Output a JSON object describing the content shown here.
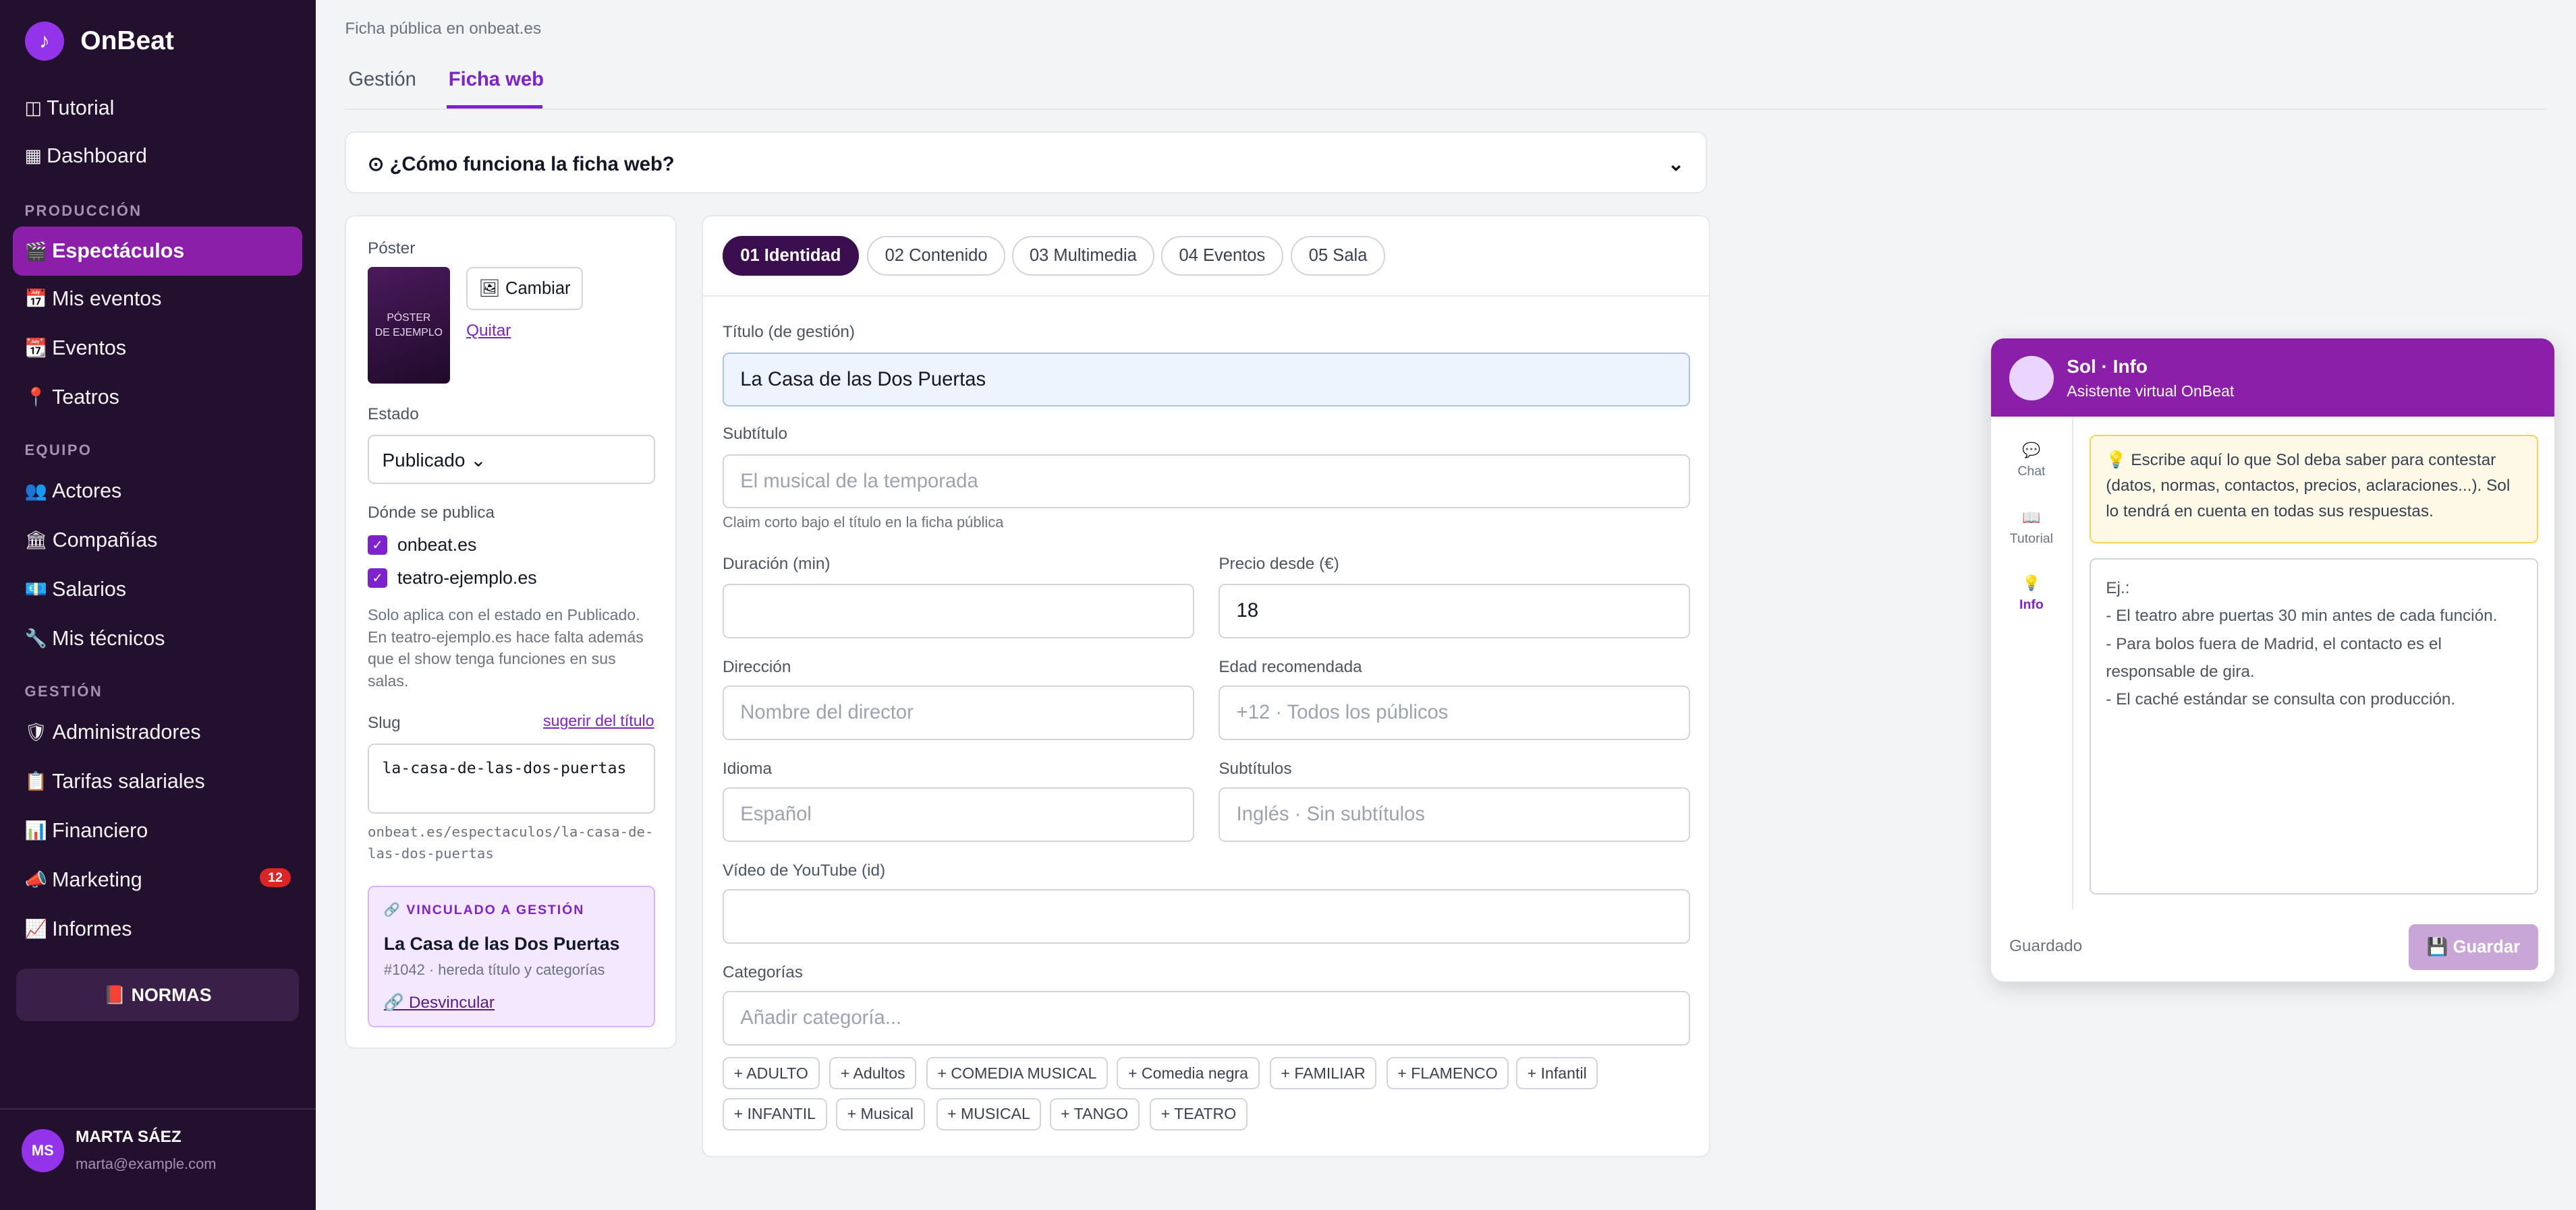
{
  "brand": {
    "logo_icon": "♪",
    "name": "OnBeat"
  },
  "sidebar": {
    "items_top": [
      {
        "icon": "◫",
        "label": "Tutorial"
      },
      {
        "icon": "▦",
        "label": "Dashboard"
      }
    ],
    "section_produccion": "PRODUCCIÓN",
    "items_produccion": [
      {
        "icon": "🎬",
        "label": "Espectáculos"
      },
      {
        "icon": "📅",
        "label": "Mis eventos"
      },
      {
        "icon": "📆",
        "label": "Eventos"
      },
      {
        "icon": "📍",
        "label": "Teatros"
      }
    ],
    "section_equipo": "EQUIPO",
    "items_equipo": [
      {
        "icon": "👥",
        "label": "Actores"
      },
      {
        "icon": "🏛",
        "label": "Compañías"
      },
      {
        "icon": "💶",
        "label": "Salarios"
      },
      {
        "icon": "🔧",
        "label": "Mis técnicos"
      }
    ],
    "section_gestion": "GESTIÓN",
    "items_gestion": [
      {
        "icon": "🛡",
        "label": "Administradores"
      },
      {
        "icon": "📋",
        "label": "Tarifas salariales"
      },
      {
        "icon": "📊",
        "label": "Financiero"
      },
      {
        "icon": "📣",
        "label": "Marketing",
        "badge": "12"
      },
      {
        "icon": "📈",
        "label": "Informes"
      }
    ],
    "normas_label": "📕 NORMAS",
    "user": {
      "initials": "MS",
      "name": "MARTA SÁEZ",
      "email": "marta@example.com"
    }
  },
  "main": {
    "breadcrumb": "Ficha pública en onbeat.es",
    "tabs": [
      {
        "label": "Gestión"
      },
      {
        "label": "Ficha web"
      }
    ],
    "accordion_title": "⊙ ¿Cómo funciona la ficha web?",
    "accordion_chevron": "⌄",
    "left": {
      "poster_label": "Póster",
      "poster_caption_1": "PÓSTER",
      "poster_caption_2": "DE EJEMPLO",
      "change_button": "🖼 Cambiar",
      "remove_link": "Quitar",
      "estado_label": "Estado",
      "estado_value": "Publicado ⌄",
      "publish_label": "Dónde se publica",
      "channels": [
        {
          "label": "onbeat.es",
          "checked": true
        },
        {
          "label": "teatro-ejemplo.es",
          "checked": true
        }
      ],
      "publish_note": "Solo aplica con el estado en Publicado. En teatro-ejemplo.es hace falta además que el show tenga funciones en sus salas.",
      "slug_label": "Slug",
      "slug_suggest": "sugerir del título",
      "slug_value": "la-casa-de-las-dos-puertas",
      "slug_url": "onbeat.es/espectaculos/la-casa-de-las-dos-puertas",
      "linked": {
        "tag": "🔗 VINCULADO A GESTIÓN",
        "title": "La Casa de las Dos Puertas",
        "subtitle": "#1042 · hereda título y categorías",
        "unlink": "🔗 Desvincular"
      }
    },
    "step_tabs": [
      {
        "label": "01 Identidad"
      },
      {
        "label": "02 Contenido"
      },
      {
        "label": "03 Multimedia"
      },
      {
        "label": "04 Eventos"
      },
      {
        "label": "05 Sala"
      }
    ],
    "form": {
      "titulo_label": "Título (de gestión)",
      "titulo_value": "La Casa de las Dos Puertas",
      "subtitulo_label": "Subtítulo",
      "subtitulo_placeholder": "El musical de la temporada",
      "subtitulo_hint": "Claim corto bajo el título en la ficha pública",
      "duracion_label": "Duración (min)",
      "duracion_value": "",
      "precio_label": "Precio desde (€)",
      "precio_value": "18",
      "direccion_label": "Dirección",
      "direccion_placeholder": "Nombre del director",
      "edad_label": "Edad recomendada",
      "edad_placeholder": "+12 · Todos los públicos",
      "idioma_label": "Idioma",
      "idioma_placeholder": "Español",
      "subtitulos_label": "Subtítulos",
      "subtitulos_placeholder": "Inglés · Sin subtítulos",
      "youtube_label": "Vídeo de YouTube (id)",
      "youtube_value": "",
      "categorias_label": "Categorías",
      "categorias_placeholder": "Añadir categoría...",
      "chips_row1": [
        "+ ADULTO",
        "+ Adultos",
        "+ COMEDIA MUSICAL",
        "+ Comedia negra",
        "+ FAMILIAR",
        "+ FLAMENCO",
        "+ Infantil"
      ],
      "chips_row2": [
        "+ INFANTIL",
        "+ Musical",
        "+ MUSICAL",
        "+ TANGO",
        "+ TEATRO"
      ]
    }
  },
  "assistant": {
    "title": "Sol · Info",
    "subtitle": "Asistente virtual OnBeat",
    "nav": [
      {
        "icon": "💬",
        "label": "Chat"
      },
      {
        "icon": "📖",
        "label": "Tutorial"
      },
      {
        "icon": "💡",
        "label": "Info"
      }
    ],
    "tip": "💡 Escribe aquí lo que Sol deba saber para contestar (datos, normas, contactos, precios, aclaraciones...). Sol lo tendrá en cuenta en todas sus respuestas.",
    "textarea_lines": [
      "Ej.:",
      "- El teatro abre puertas 30 min antes de cada función.",
      "- Para bolos fuera de Madrid, el contacto es el responsable de gira.",
      "- El caché estándar se consulta con producción."
    ],
    "status": "Guardado",
    "save_label": "💾 Guardar"
  }
}
